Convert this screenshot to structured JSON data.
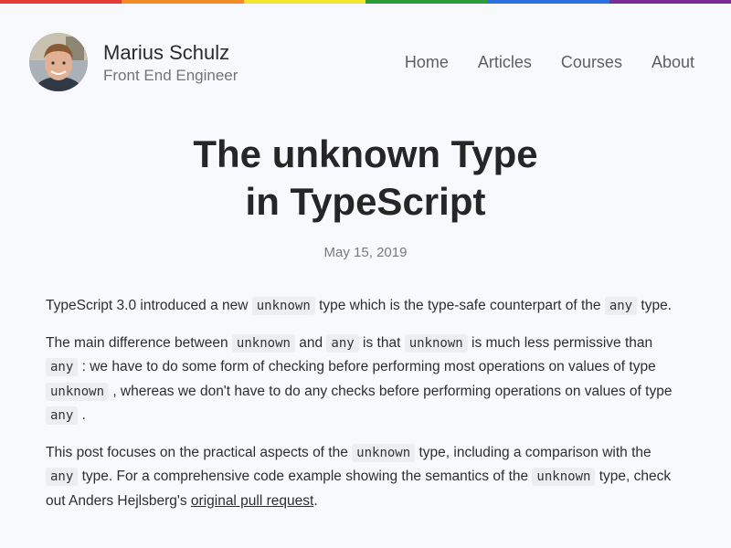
{
  "rainbow": [
    "#e53935",
    "#f48c25",
    "#f4e52d",
    "#2e9b3a",
    "#2b6fe0",
    "#7c2b95"
  ],
  "header": {
    "name": "Marius Schulz",
    "tagline": "Front End Engineer",
    "nav": [
      "Home",
      "Articles",
      "Courses",
      "About"
    ]
  },
  "article": {
    "title_line1": "The unknown Type",
    "title_line2": "in TypeScript",
    "date": "May 15, 2019",
    "p1": {
      "t1": "TypeScript 3.0 introduced a new ",
      "c1": "unknown",
      "t2": " type which is the type-safe counterpart of the ",
      "c2": "any",
      "t3": " type."
    },
    "p2": {
      "t1": "The main difference between ",
      "c1": "unknown",
      "t2": " and ",
      "c2": "any",
      "t3": " is that ",
      "c3": "unknown",
      "t4": " is much less permissive than ",
      "c4": "any",
      "t5": " : we have to do some form of checking before performing most operations on values of type ",
      "c5": "unknown",
      "t6": " , whereas we don't have to do any checks before performing operations on values of type ",
      "c6": "any",
      "t7": " ."
    },
    "p3": {
      "t1": "This post focuses on the practical aspects of the ",
      "c1": "unknown",
      "t2": " type, including a comparison with the ",
      "c2": "any",
      "t3": " type. For a comprehensive code example showing the semantics of the ",
      "c3": "unknown",
      "t4": " type, check out Anders Hejlsberg's ",
      "link": "original pull request",
      "t5": "."
    }
  }
}
